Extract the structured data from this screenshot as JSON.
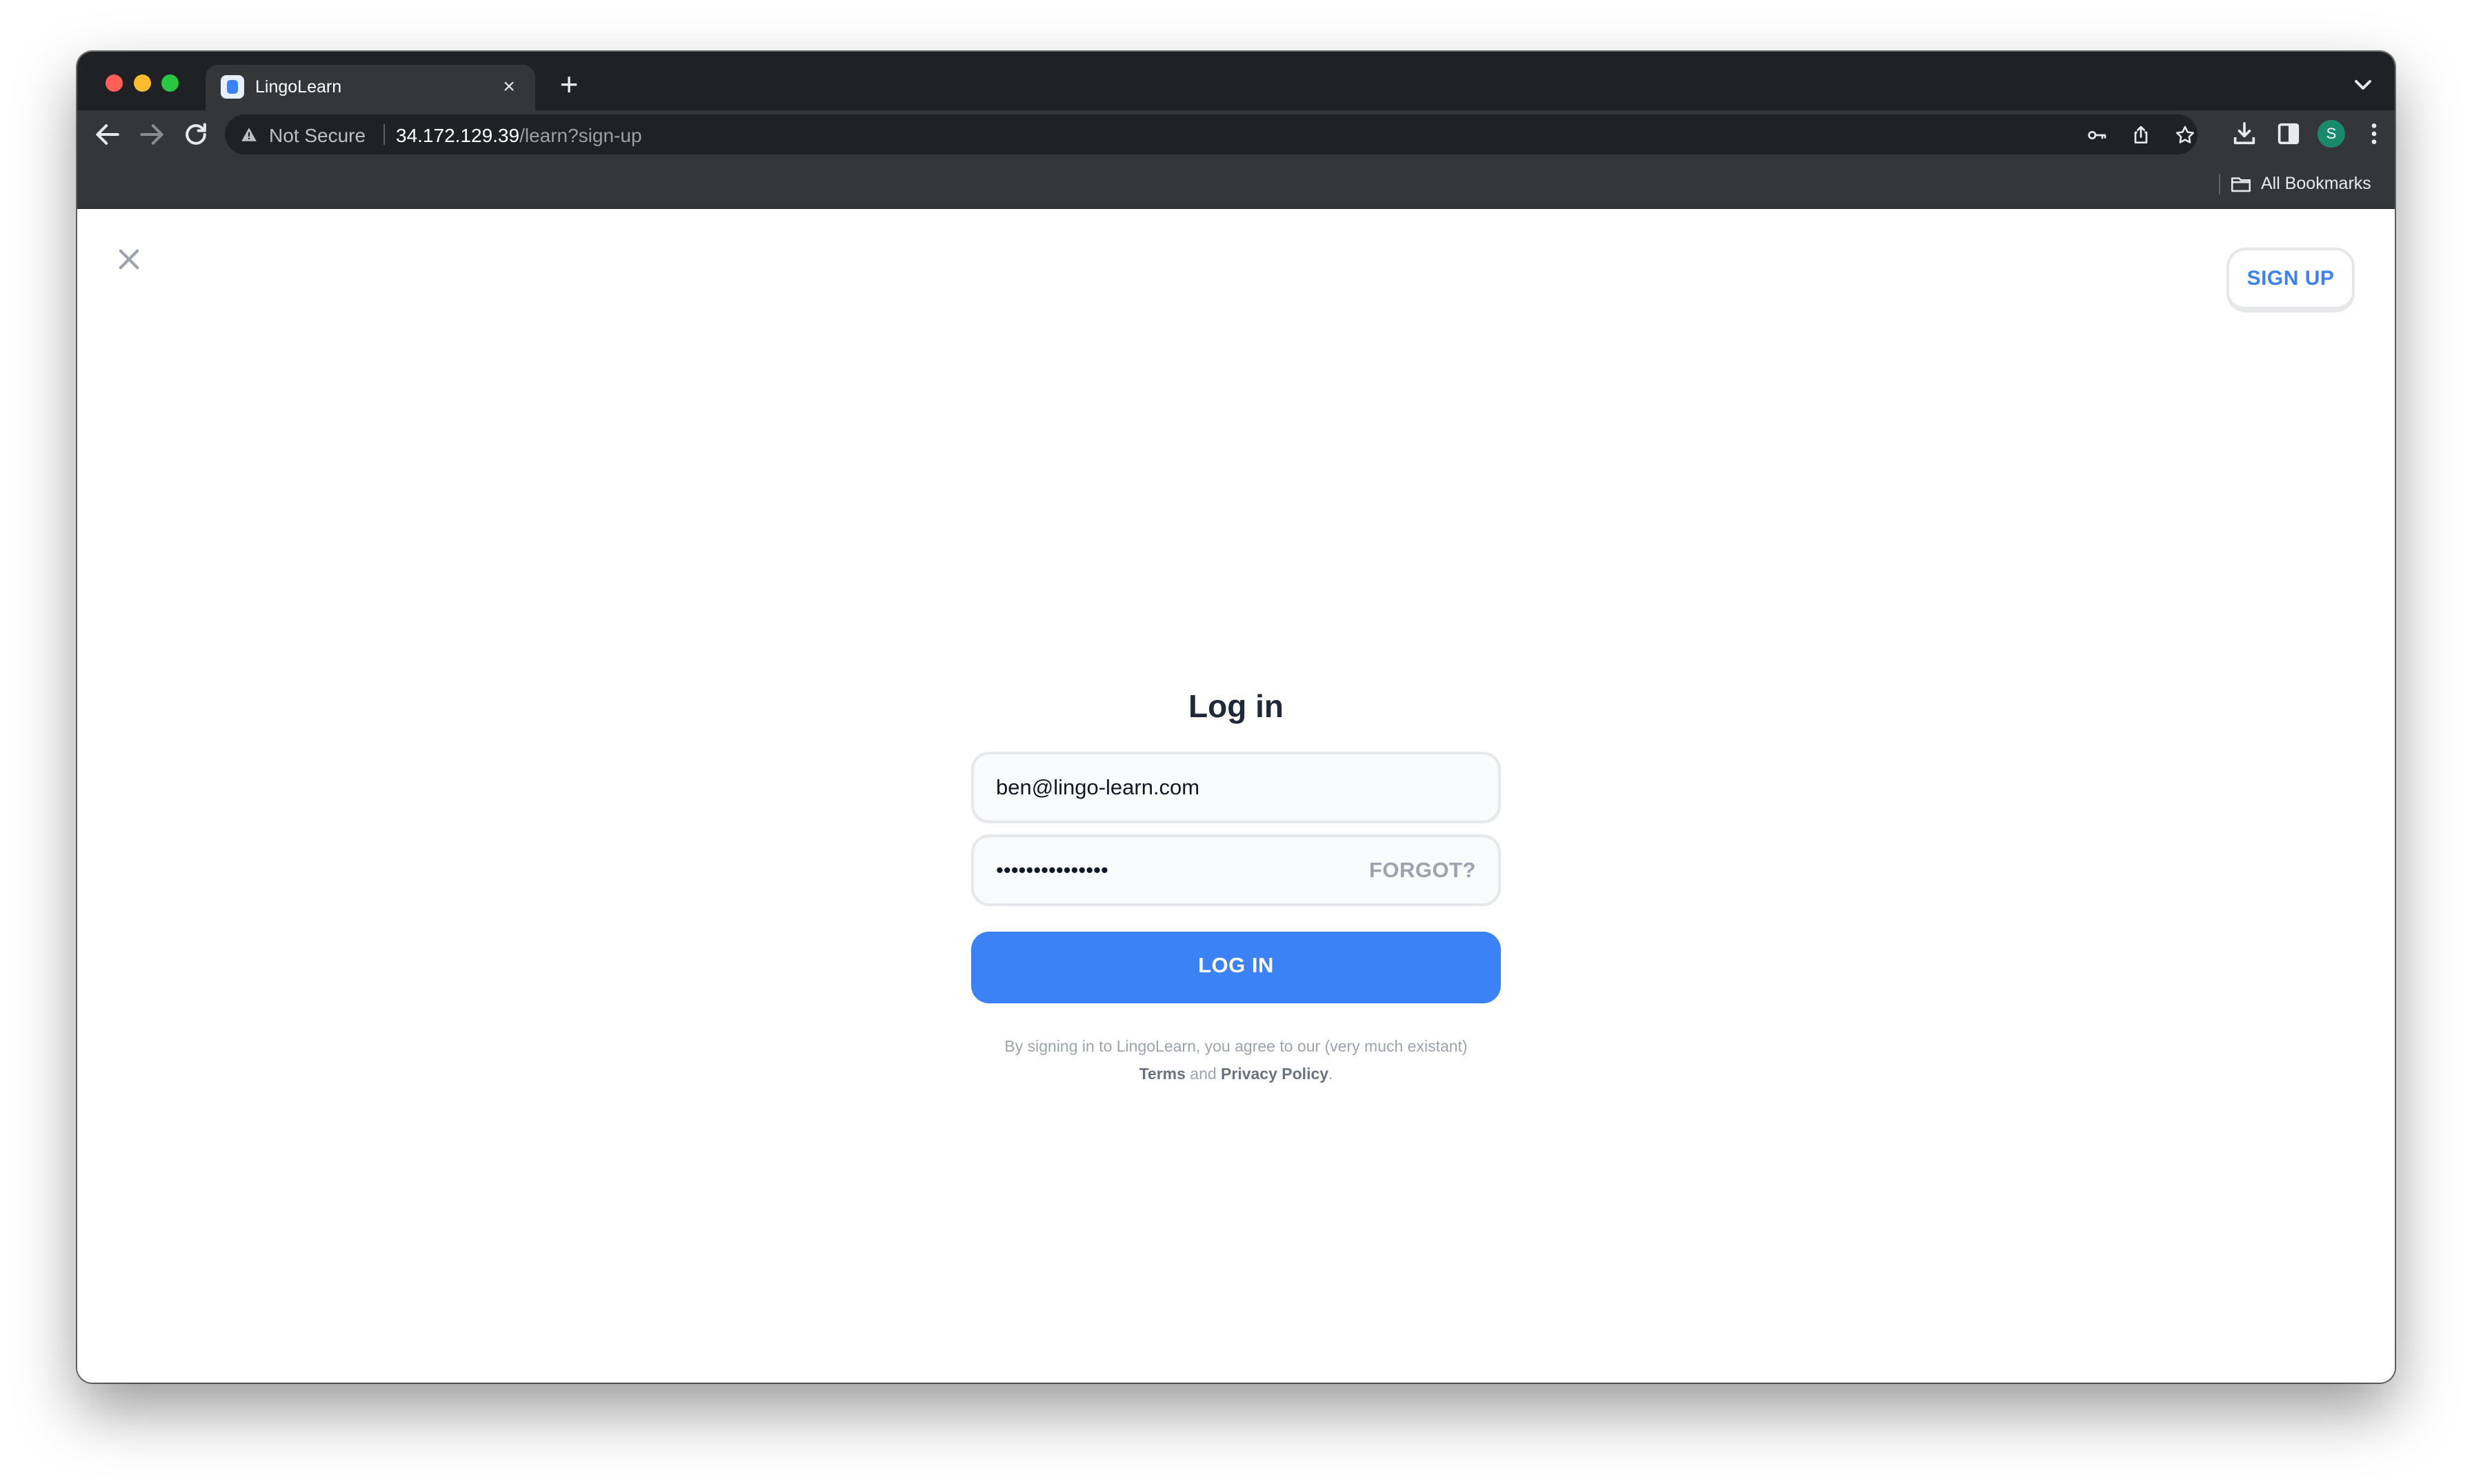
{
  "browser": {
    "tab_title": "LingoLearn",
    "security_label": "Not Secure",
    "url_host": "34.172.129.39",
    "url_path": "/learn?sign-up",
    "avatar_initial": "S",
    "bookmarks_label": "All Bookmarks"
  },
  "header": {
    "signup_label": "SIGN UP"
  },
  "login": {
    "title": "Log in",
    "email_value": "ben@lingo-learn.com",
    "password_value": "•••••••••••••••",
    "forgot_label": "FORGOT?",
    "submit_label": "LOG IN",
    "legal_prefix": "By signing in to LingoLearn, you agree to our (very much existant)",
    "terms_label": "Terms",
    "and_text": "and",
    "privacy_label": "Privacy Policy",
    "legal_suffix": "."
  },
  "colors": {
    "accent": "#3b82f6",
    "browser_frame": "#202124",
    "browser_toolbar": "#35363a"
  }
}
